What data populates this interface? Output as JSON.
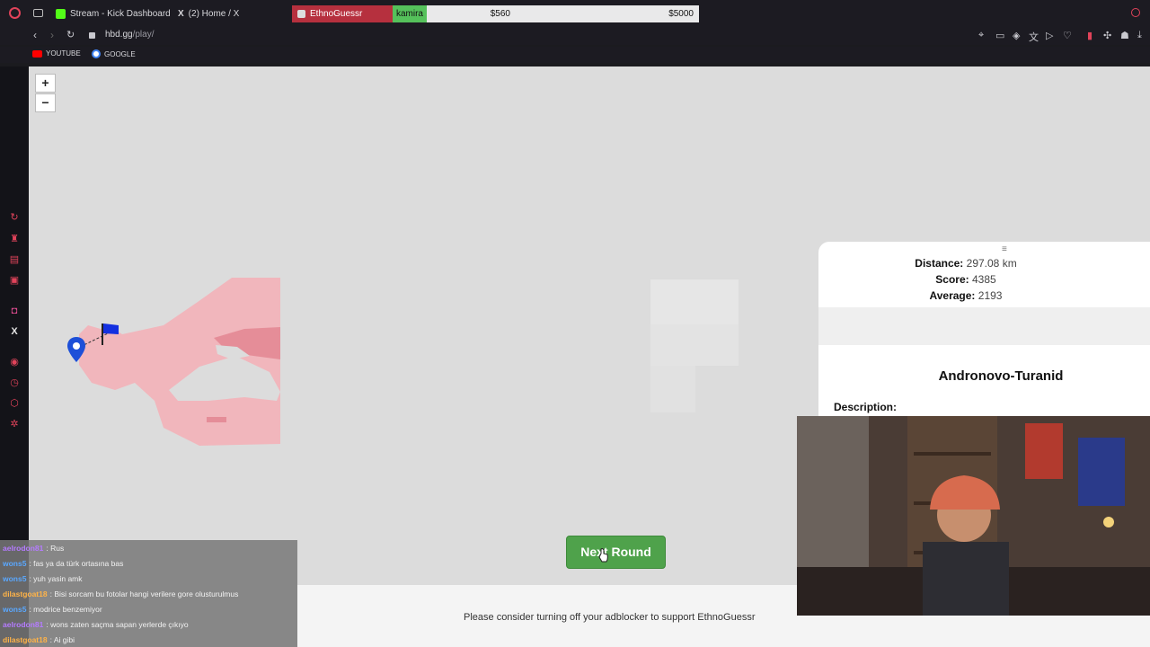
{
  "browser": {
    "tabs": [
      {
        "label": "Stream - Kick Dashboard",
        "icon": "kick-icon"
      },
      {
        "label": "(2) Home / X",
        "icon": "x-icon"
      }
    ],
    "url_host": "hbd.gg",
    "url_path": "/play/",
    "bookmarks": [
      {
        "label": "YOUTUBE",
        "icon": "youtube-icon"
      },
      {
        "label": "GOOGLE",
        "icon": "google-icon"
      }
    ]
  },
  "stream_overlay": {
    "game": "EthnoGuessr",
    "user": "kamira",
    "current_amount": "$560",
    "goal_amount": "$5000"
  },
  "map": {
    "zoom_in": "+",
    "zoom_out": "−"
  },
  "result": {
    "distance_label": "Distance:",
    "distance_value": "297.08 km",
    "score_label": "Score:",
    "score_value": "4385",
    "average_label": "Average:",
    "average_value": "2193",
    "culture": "Andronovo-Turanid",
    "description_label": "Description:"
  },
  "next_round": "Next Round",
  "adblock_notice": "Please consider turning off your adblocker to support EthnoGuessr",
  "chat": [
    {
      "user": "aelrodon81",
      "message": ": Rus"
    },
    {
      "user": "wons5",
      "message": ": fas ya da türk ortasına bas"
    },
    {
      "user": "wons5",
      "message": ": yuh yasin amk"
    },
    {
      "user": "dilastgoat18",
      "message": ": Bisi sorcam bu fotolar hangi verilere gore olusturulmus"
    },
    {
      "user": "wons5",
      "message": ": modrice benzemiyor"
    },
    {
      "user": "aelrodon81",
      "message": ": wons zaten saçma sapan yerlerde çıkıyo"
    },
    {
      "user": "dilastgoat18",
      "message": ": Ai gibi"
    }
  ]
}
